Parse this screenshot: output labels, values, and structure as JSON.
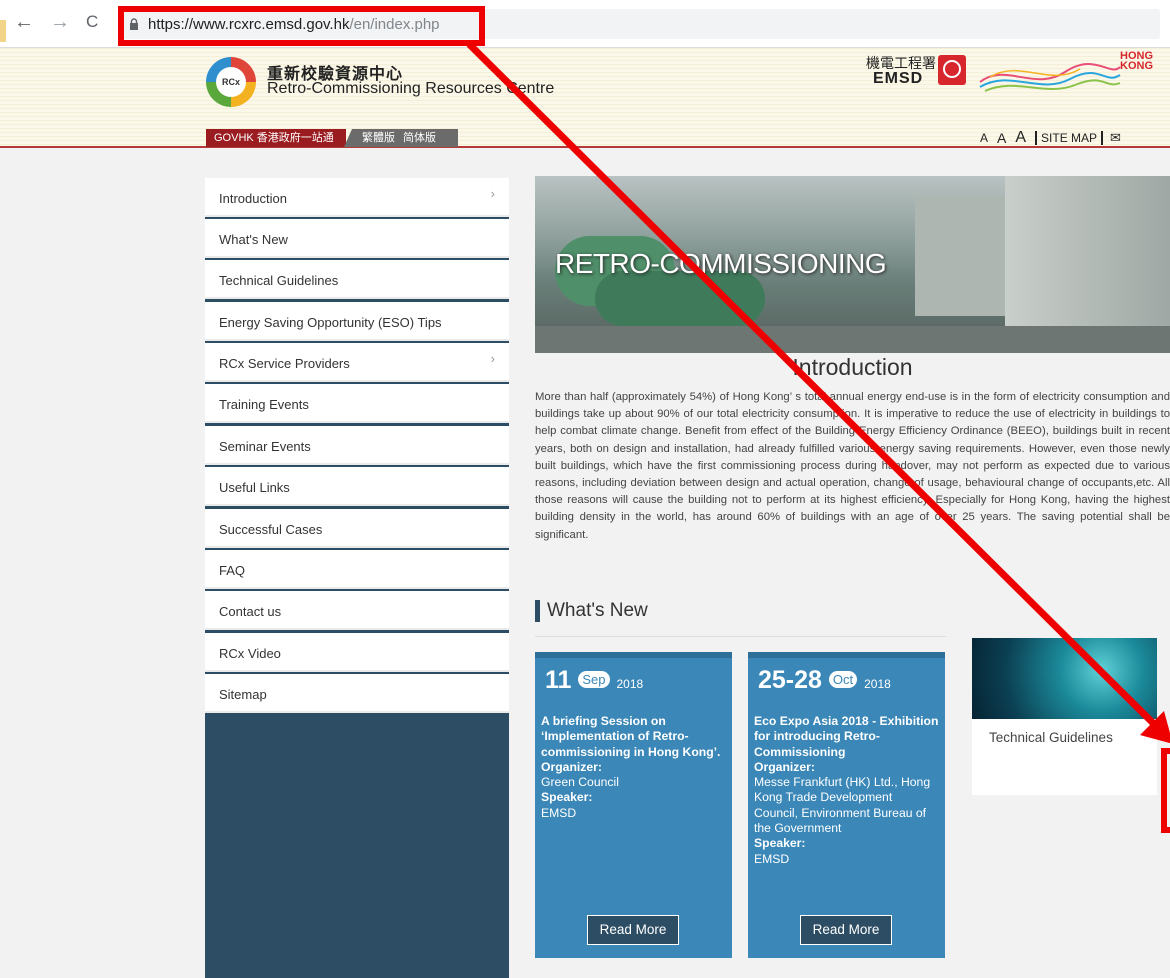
{
  "browser": {
    "back": "←",
    "forward": "→",
    "reload": "C",
    "url_host": "https://www.rcxrc.emsd.gov.hk",
    "url_path": "/en/index.php"
  },
  "header": {
    "logo_text": "RCx",
    "title_zh": "重新校驗資源中心",
    "title_en": "Retro-Commissioning Resources Centre",
    "dept_zh": "機電工程署",
    "dept_en": "EMSD",
    "hk_brand": "HONG KONG",
    "govhk": "GOVHK 香港政府一站通",
    "lang_trad": "繁體版",
    "lang_simp": "简体版",
    "font_small": "A",
    "font_medium": "A",
    "font_large": "A",
    "sitemap": "SITE MAP",
    "mail_icon": "✉"
  },
  "sidebar": {
    "items": [
      {
        "label": "Introduction",
        "chevron": "›"
      },
      {
        "label": "What's New",
        "chevron": ""
      },
      {
        "label": "Technical Guidelines",
        "chevron": ""
      },
      {
        "label": "Energy Saving Opportunity (ESO) Tips",
        "chevron": ""
      },
      {
        "label": "RCx Service Providers",
        "chevron": "›"
      },
      {
        "label": "Training Events",
        "chevron": ""
      },
      {
        "label": "Seminar Events",
        "chevron": ""
      },
      {
        "label": "Useful Links",
        "chevron": ""
      },
      {
        "label": "Successful Cases",
        "chevron": ""
      },
      {
        "label": "FAQ",
        "chevron": ""
      },
      {
        "label": "Contact us",
        "chevron": ""
      },
      {
        "label": "RCx Video",
        "chevron": ""
      },
      {
        "label": "Sitemap",
        "chevron": ""
      }
    ]
  },
  "main": {
    "banner_title": "RETRO-COMMISSIONING",
    "intro_heading": "Introduction",
    "intro_text": "More than half (approximately 54%) of Hong Kong’ s total annual energy end-use is in the form of electricity consumption and buildings take up about 90% of our total electricity consumption. It is imperative to reduce the use of electricity in buildings to help combat climate change. Benefit from effect of the Building Energy Efficiency Ordinance (BEEO), buildings built in recent years, both on design and installation, had already fulfilled various energy saving requirements. However, even those newly built buildings, which have the first commissioning process during handover, may not perform as expected due to various reasons, including deviation between design and actual operation, change of usage, behavioural change of occupants,etc. All those reasons will cause the building not to perform at its highest efficiency. Especially for Hong Kong, having the highest building density in the world, has around 60% of buildings with an age of over 25 years. The saving potential shall be significant.",
    "whats_new_heading": "What's New",
    "news": [
      {
        "day": "11",
        "month": "Sep",
        "year": "2018",
        "title": "A briefing Session on ‘Implementation of Retro-commissioning in Hong Kong’.",
        "organizer_label": "Organizer:",
        "organizer": "Green Council",
        "speaker_label": "Speaker:",
        "speaker": "EMSD",
        "read_more": "Read More"
      },
      {
        "day": "25-28",
        "month": "Oct",
        "year": "2018",
        "title": "Eco Expo Asia 2018 - Exhibition for introducing Retro-Commissioning",
        "organizer_label": "Organizer:",
        "organizer": "Messe Frankfurt (HK) Ltd., Hong Kong Trade Development Council, Environment Bureau of the Government",
        "speaker_label": "Speaker:",
        "speaker": "EMSD",
        "read_more": "Read More"
      }
    ],
    "tech_guidelines_caption": "Technical Guidelines"
  },
  "colors": {
    "annotation": "#ee0000",
    "sidebar_dark": "#2d4d64",
    "news_card": "#3a87b8",
    "header_red": "#b43a3a"
  }
}
